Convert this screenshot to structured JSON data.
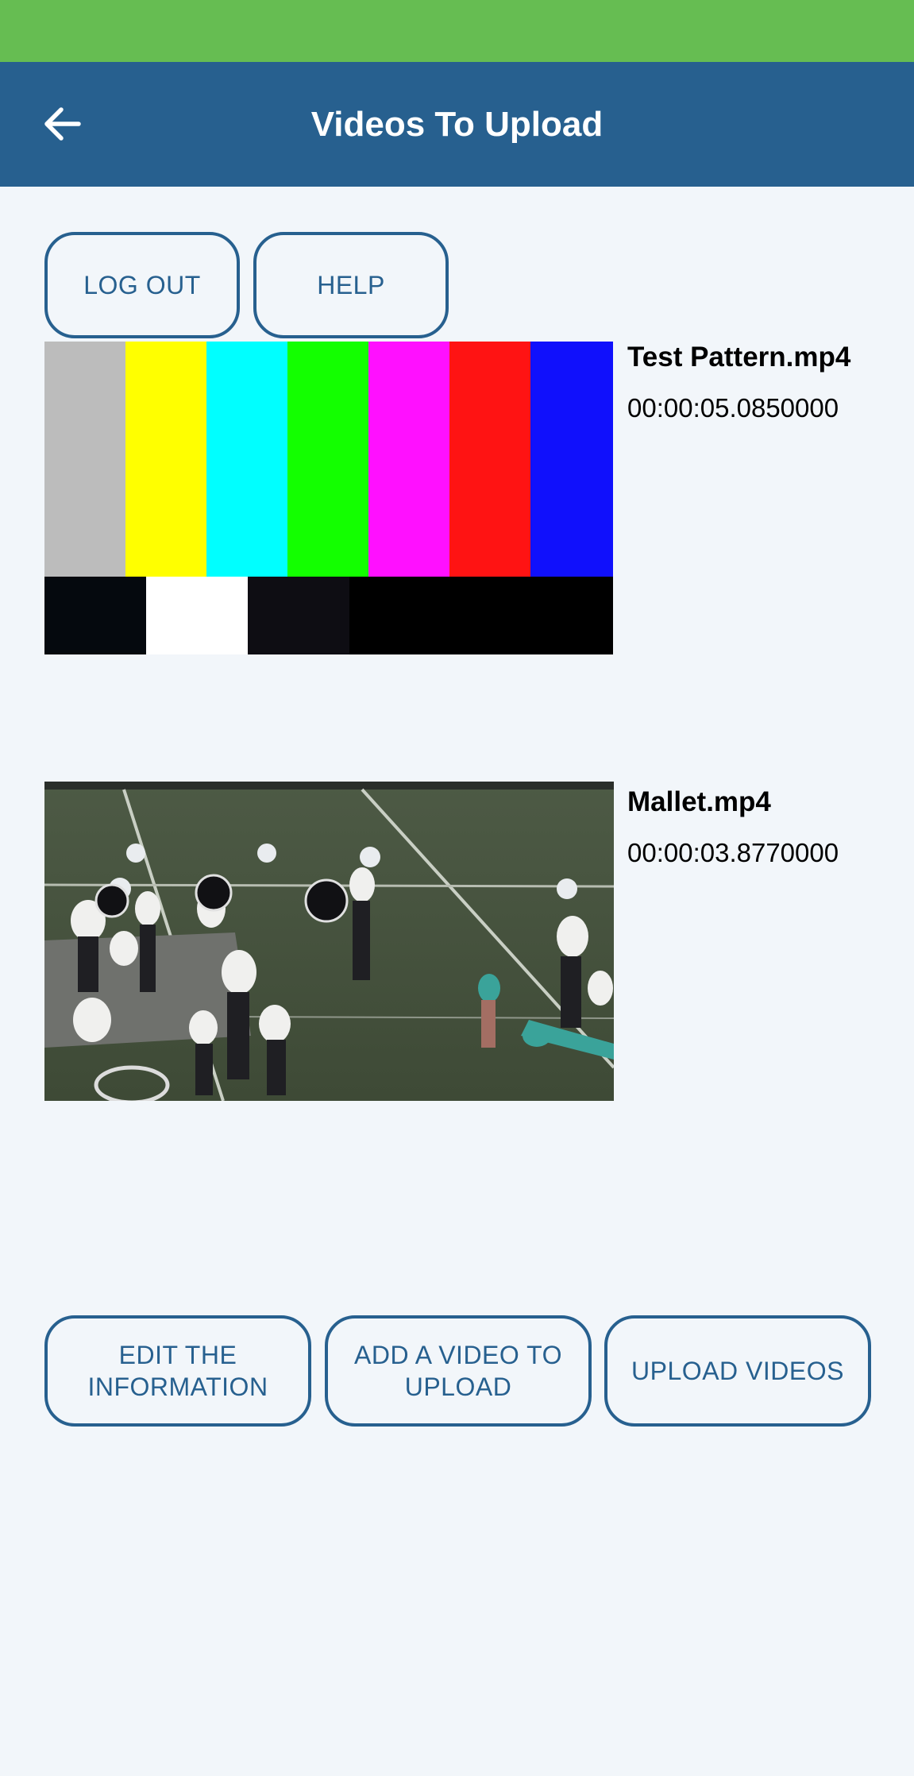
{
  "app_bar": {
    "title": "Videos To Upload",
    "back_icon": "arrow-left-icon"
  },
  "top_buttons": {
    "logout_label": "LOG OUT",
    "help_label": "HELP"
  },
  "videos": [
    {
      "name": "Test Pattern.mp4",
      "duration": "00:00:05.0850000",
      "thumbnail": "color-bars-test-pattern"
    },
    {
      "name": "Mallet.mp4",
      "duration": "00:00:03.8770000",
      "thumbnail": "marching-band-field"
    }
  ],
  "bottom_buttons": {
    "edit_label": "EDIT THE\nINFORMATION",
    "add_label": "ADD A VIDEO TO\nUPLOAD",
    "upload_label": "UPLOAD VIDEOS"
  },
  "colors": {
    "status_bar": "#66bd52",
    "app_bar": "#27608f",
    "background": "#f2f6fa",
    "accent": "#27608f"
  }
}
